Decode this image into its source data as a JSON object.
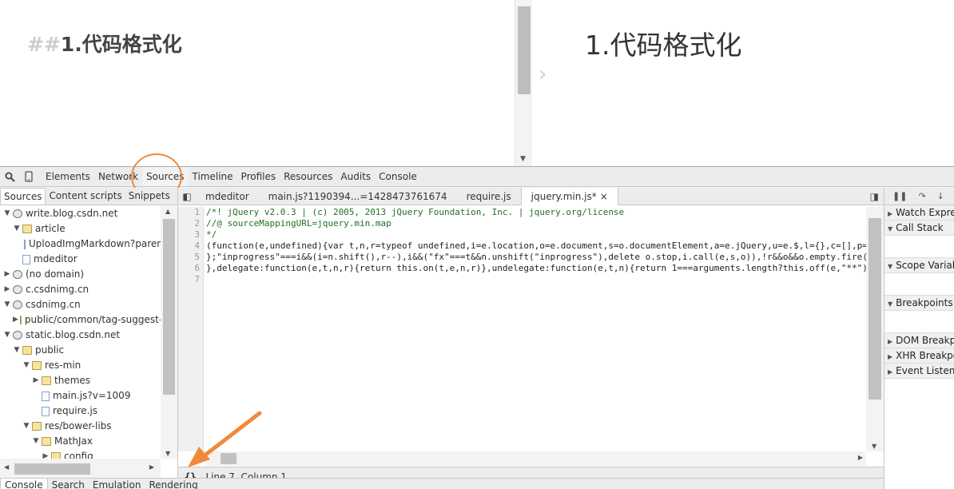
{
  "editor": {
    "markdown_hash": "##",
    "heading_text": "1.代码格式化"
  },
  "preview": {
    "heading": "1.代码格式化"
  },
  "devtools": {
    "main_tabs": [
      "Elements",
      "Network",
      "Sources",
      "Timeline",
      "Profiles",
      "Resources",
      "Audits",
      "Console"
    ],
    "active_tab": "Sources",
    "nav_tabs": [
      "Sources",
      "Content scripts",
      "Snippets"
    ],
    "tree": [
      {
        "indent": 0,
        "toggle": "▼",
        "icon": "globe",
        "label": "write.blog.csdn.net"
      },
      {
        "indent": 1,
        "toggle": "▼",
        "icon": "folder",
        "label": "article"
      },
      {
        "indent": 2,
        "toggle": "",
        "icon": "file",
        "label": "UploadImgMarkdown?paren"
      },
      {
        "indent": 1,
        "toggle": "",
        "icon": "file",
        "label": "mdeditor"
      },
      {
        "indent": 0,
        "toggle": "▶",
        "icon": "globe",
        "label": "(no domain)"
      },
      {
        "indent": 0,
        "toggle": "▶",
        "icon": "globe",
        "label": "c.csdnimg.cn"
      },
      {
        "indent": 0,
        "toggle": "▼",
        "icon": "globe",
        "label": "csdnimg.cn"
      },
      {
        "indent": 1,
        "toggle": "▶",
        "icon": "folder",
        "label": "public/common/tag-suggest-"
      },
      {
        "indent": 0,
        "toggle": "▼",
        "icon": "globe",
        "label": "static.blog.csdn.net"
      },
      {
        "indent": 1,
        "toggle": "▼",
        "icon": "folder",
        "label": "public"
      },
      {
        "indent": 2,
        "toggle": "▼",
        "icon": "folder",
        "label": "res-min"
      },
      {
        "indent": 3,
        "toggle": "▶",
        "icon": "folder",
        "label": "themes"
      },
      {
        "indent": 3,
        "toggle": "",
        "icon": "file",
        "label": "main.js?v=1009"
      },
      {
        "indent": 3,
        "toggle": "",
        "icon": "file",
        "label": "require.js"
      },
      {
        "indent": 2,
        "toggle": "▼",
        "icon": "folder",
        "label": "res/bower-libs"
      },
      {
        "indent": 3,
        "toggle": "▼",
        "icon": "folder",
        "label": "MathJax"
      },
      {
        "indent": 4,
        "toggle": "▶",
        "icon": "folder",
        "label": "config"
      }
    ],
    "file_tabs": [
      {
        "label": "mdeditor",
        "active": false
      },
      {
        "label": "main.js?1190394...=1428473761674",
        "active": false
      },
      {
        "label": "require.js",
        "active": false
      },
      {
        "label": "jquery.min.js*",
        "active": true
      }
    ],
    "close_glyph": "×",
    "line_numbers": [
      "1",
      "2",
      "3",
      "4",
      "5",
      "6",
      "7"
    ],
    "code_lines": [
      {
        "text": "/*! jQuery v2.0.3 | (c) 2005, 2013 jQuery Foundation, Inc. | jquery.org/license",
        "comment": true
      },
      {
        "text": "//@ sourceMappingURL=jquery.min.map",
        "comment": true
      },
      {
        "text": "*/",
        "comment": true
      },
      {
        "text": "(function(e,undefined){var t,n,r=typeof undefined,i=e.location,o=e.document,s=o.documentElement,a=e.jQuery,u=e.$,l={},c=[],p=\"",
        "comment": false
      },
      {
        "text": "};\"inprogress\"===i&&(i=n.shift(),r--),i&&(\"fx\"===t&&n.unshift(\"inprogress\"),delete o.stop,i.call(e,s,o)),!r&&o&&o.empty.fire()",
        "comment": false
      },
      {
        "text": "},delegate:function(e,t,n,r){return this.on(t,e,n,r)},undelegate:function(e,t,n){return 1===arguments.length?this.off(e,\"**\")",
        "comment": false
      },
      {
        "text": "",
        "comment": false
      }
    ],
    "status": {
      "pretty_print": "{}",
      "position": "Line 7, Column 1"
    },
    "debug_panes": [
      {
        "label": "Watch Expressions",
        "expanded": false
      },
      {
        "label": "Call Stack",
        "expanded": true
      },
      {
        "label": "Scope Variables",
        "expanded": true
      },
      {
        "label": "Breakpoints",
        "expanded": true
      },
      {
        "label": "DOM Breakpoints",
        "expanded": false
      },
      {
        "label": "XHR Breakpoints",
        "expanded": false
      },
      {
        "label": "Event Listener Breakpoints",
        "expanded": false
      }
    ],
    "drawer_tabs": [
      "Console",
      "Search",
      "Emulation",
      "Rendering"
    ],
    "annotation_color": "#ef8a3c"
  }
}
